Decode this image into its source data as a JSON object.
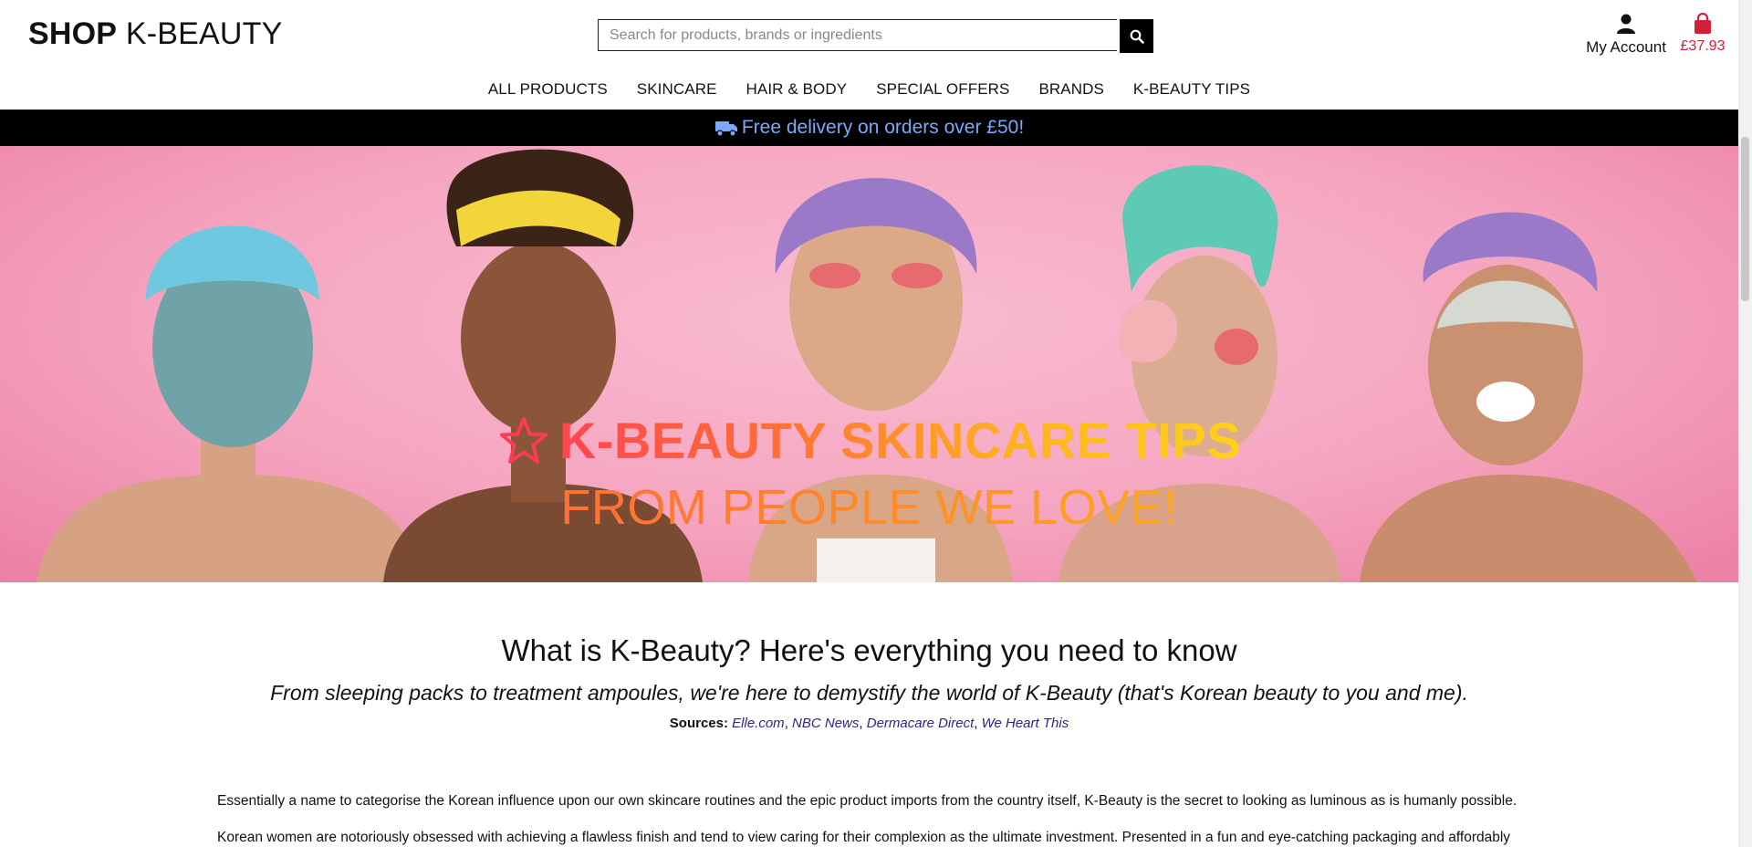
{
  "header": {
    "logo_bold": "SHOP",
    "logo_light": "K-BEAUTY",
    "search_placeholder": "Search for products, brands or ingredients",
    "account_label": "My Account",
    "cart_total": "£37.93"
  },
  "nav": {
    "items": [
      "ALL PRODUCTS",
      "SKINCARE",
      "HAIR & BODY",
      "SPECIAL OFFERS",
      "BRANDS",
      "K-BEAUTY TIPS"
    ]
  },
  "delivery": {
    "text": "Free delivery on orders over £50!"
  },
  "hero": {
    "title_line1": "K-BEAUTY SKINCARE TIPS",
    "title_line2": "FROM PEOPLE WE LOVE!"
  },
  "article": {
    "heading": "What is K-Beauty? Here's everything you need to know",
    "subheading": "From sleeping packs to treatment ampoules, we're here to demystify the world of K-Beauty (that's Korean beauty to you and me).",
    "sources_label": "Sources:",
    "sources": [
      "Elle.com",
      "NBC News",
      "Dermacare Direct",
      "We Heart This"
    ],
    "para1": "Essentially a name to categorise the Korean influence upon our own skincare routines and the epic product imports from the country itself, K-Beauty is the secret to looking as luminous as is humanly possible.",
    "para2": "Korean women are notoriously obsessed with achieving a flawless finish and tend to view caring for their complexion as the ultimate investment. Presented in a fun and eye-catching packaging and affordably"
  },
  "colors": {
    "accent_red": "#d3203a",
    "delivery_text": "#7ba8ff",
    "link": "#2c2680",
    "hero_pink": "#f5a5c0"
  },
  "icons": {
    "search": "search-icon",
    "account": "user-icon",
    "cart": "shopping-bag-icon",
    "delivery": "truck-icon",
    "hero": "star-icon"
  }
}
